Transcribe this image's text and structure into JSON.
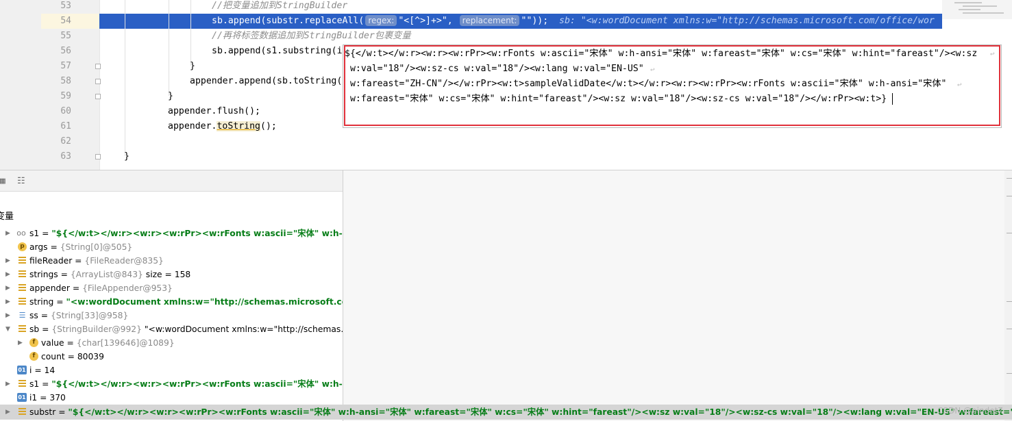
{
  "editor": {
    "line_numbers": [
      "53",
      "54",
      "55",
      "56",
      "57",
      "58",
      "59",
      "60",
      "61",
      "62",
      "63"
    ],
    "line53_comment": "//把变量追加到StringBuilder",
    "line54_a": "sb.append(substr.replaceAll(",
    "line54_hint_regex": "regex:",
    "line54_regex_value": "\"<[^>]+>\"",
    "line54_comma": ", ",
    "line54_hint_replacement": "replacement:",
    "line54_replacement_value": "\"\"",
    "line54_end": "));",
    "line54_inline_value": "sb: \"<w:wordDocument xmlns:w=\"http://schemas.microsoft.com/office/wor",
    "line55_comment": "//再将标签数据追加到StringBuilder包裹变量",
    "line56": "sb.append(s1.substring(i",
    "line57": "}",
    "line58": "appender.append(sb.toString(",
    "line59": "}",
    "line60": "appender.flush();",
    "line61_a": "appender.",
    "line61_b": "toString",
    "line61_c": "();",
    "line63": "}"
  },
  "popup": {
    "lines": [
      "${</w:t></w:r><w:r><w:rPr><w:rFonts w:ascii=\"宋体\" w:h-ansi=\"宋体\" w:fareast=\"宋体\" w:cs=\"宋体\" w:hint=\"fareast\"/><w:sz",
      " w:val=\"18\"/><w:sz-cs w:val=\"18\"/><w:lang w:val=\"EN-US\"",
      " w:fareast=\"ZH-CN\"/></w:rPr><w:t>sampleValidDate</w:t></w:r><w:r><w:rPr><w:rFonts w:ascii=\"宋体\" w:h-ansi=\"宋体\"",
      " w:fareast=\"宋体\" w:cs=\"宋体\" w:hint=\"fareast\"/><w:sz w:val=\"18\"/><w:sz-cs w:val=\"18\"/></w:rPr><w:t>}"
    ],
    "wrap_icon": "↩"
  },
  "debug": {
    "variables_title": "变量",
    "vars": [
      {
        "name": "s1",
        "eq": " = ",
        "value": "\"${</w:t></w:r><w:r><w:rPr><w:rFonts w:ascii=\"宋体\" w:h-ansi=\"宋体",
        "icon": "oo"
      },
      {
        "name": "args",
        "eq": " = ",
        "type": "{String[0]@505}",
        "icon": "p",
        "icon_text": "p"
      },
      {
        "name": "fileReader",
        "eq": " = ",
        "type": "{FileReader@835}",
        "icon": "stack"
      },
      {
        "name": "strings",
        "eq": " = ",
        "type": "{ArrayList@843}",
        "extra": "  size = 158",
        "icon": "stack"
      },
      {
        "name": "appender",
        "eq": " = ",
        "type": "{FileAppender@953}",
        "icon": "stack"
      },
      {
        "name": "string",
        "eq": " = ",
        "value": "\"<w:wordDocument xmlns:w=\"http://schemas.microsoft.com/offic",
        "icon": "stack"
      },
      {
        "name": "ss",
        "eq": " = ",
        "type": "{String[33]@958}",
        "icon": "arr"
      },
      {
        "name": "sb",
        "eq": " = ",
        "type": "{StringBuilder@992}",
        "extra": " \"<w:wordDocument xmlns:w=\"http://schemas.micros",
        "icon": "stack"
      },
      {
        "name": "value",
        "eq": " = ",
        "type": "{char[139646]@1089}",
        "icon": "f",
        "icon_text": "f"
      },
      {
        "name": "count",
        "eq": " = ",
        "extra": "80039",
        "icon": "f",
        "icon_text": "f"
      },
      {
        "name": "i",
        "eq": " = ",
        "extra": "14",
        "icon": "prim",
        "icon_text": "01"
      },
      {
        "name": "s1",
        "eq": " = ",
        "value": "\"${</w:t></w:r><w:r><w:rPr><w:rFonts w:ascii=\"宋体\" w:h-ansi=\"宋体",
        "icon": "stack"
      },
      {
        "name": "i1",
        "eq": " = ",
        "extra": "370",
        "icon": "prim",
        "icon_text": "01"
      },
      {
        "name": "substr",
        "eq": " = ",
        "value": "\"${</w:t></w:r><w:r><w:rPr><w:rFonts w:ascii=\"宋体\" w:h-ansi=\"宋体\" w:fareast=\"宋体\" w:cs=\"宋体\" w:hint=\"fareast\"/><w:sz w:val=\"18\"/><w:sz-cs w:val=\"18\"/><w:lang w:val=\"EN-US\" w:fareast=\"ZH-CN\"/></w:rPr><w:t>",
        "icon": "stack"
      }
    ]
  },
  "watermark": "CSDN @pindet7"
}
